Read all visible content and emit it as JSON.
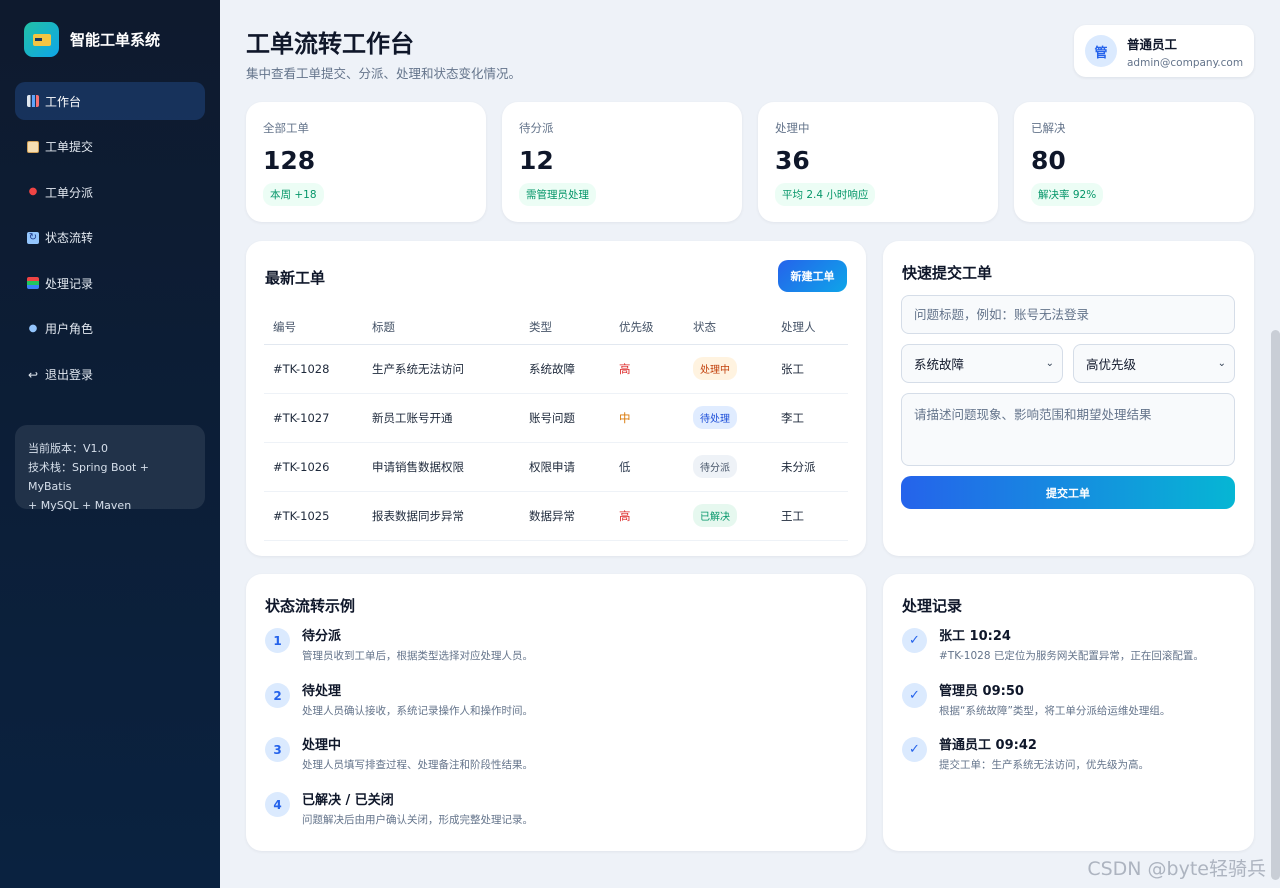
{
  "sidebar": {
    "brand": "智能工单系统",
    "items": [
      {
        "icon": "bar-chart-icon",
        "label": "工作台",
        "active": true
      },
      {
        "icon": "memo-icon",
        "label": "工单提交"
      },
      {
        "icon": "pin-icon",
        "label": "工单分派"
      },
      {
        "icon": "cycle-icon",
        "label": "状态流转"
      },
      {
        "icon": "books-icon",
        "label": "处理记录"
      },
      {
        "icon": "users-icon",
        "label": "用户角色"
      },
      {
        "icon": "return-icon",
        "label": "退出登录"
      }
    ],
    "version": {
      "line1": "当前版本：V1.0",
      "line2": "技术栈：Spring Boot + MyBatis",
      "line3": "+ MySQL + Maven"
    }
  },
  "header": {
    "title": "工单流转工作台",
    "subtitle": "集中查看工单提交、分派、处理和状态变化情况。",
    "user": {
      "avatar": "管",
      "name": "普通员工",
      "email": "admin@company.com"
    }
  },
  "stats": [
    {
      "label": "全部工单",
      "value": "128",
      "badge": "本周 +18"
    },
    {
      "label": "待分派",
      "value": "12",
      "badge": "需管理员处理"
    },
    {
      "label": "处理中",
      "value": "36",
      "badge": "平均 2.4 小时响应"
    },
    {
      "label": "已解决",
      "value": "80",
      "badge": "解决率 92%"
    }
  ],
  "tickets": {
    "title": "最新工单",
    "new_button": "新建工单",
    "columns": [
      "编号",
      "标题",
      "类型",
      "优先级",
      "状态",
      "处理人"
    ],
    "rows": [
      {
        "id": "#TK-1028",
        "title": "生产系统无法访问",
        "type": "系统故障",
        "priority": "高",
        "status": "处理中",
        "assignee": "张工"
      },
      {
        "id": "#TK-1027",
        "title": "新员工账号开通",
        "type": "账号问题",
        "priority": "中",
        "status": "待处理",
        "assignee": "李工"
      },
      {
        "id": "#TK-1026",
        "title": "申请销售数据权限",
        "type": "权限申请",
        "priority": "低",
        "status": "待分派",
        "assignee": "未分派"
      },
      {
        "id": "#TK-1025",
        "title": "报表数据同步异常",
        "type": "数据异常",
        "priority": "高",
        "status": "已解决",
        "assignee": "王工"
      }
    ]
  },
  "quick": {
    "title": "快速提交工单",
    "title_placeholder": "问题标题，例如：账号无法登录",
    "type_value": "系统故障",
    "priority_value": "高优先级",
    "desc_placeholder": "请描述问题现象、影响范围和期望处理结果",
    "submit": "提交工单"
  },
  "flow": {
    "title": "状态流转示例",
    "steps": [
      {
        "num": "1",
        "title": "待分派",
        "desc": "管理员收到工单后，根据类型选择对应处理人员。"
      },
      {
        "num": "2",
        "title": "待处理",
        "desc": "处理人员确认接收，系统记录操作人和操作时间。"
      },
      {
        "num": "3",
        "title": "处理中",
        "desc": "处理人员填写排查过程、处理备注和阶段性结果。"
      },
      {
        "num": "4",
        "title": "已解决 / 已关闭",
        "desc": "问题解决后由用户确认关闭，形成完整处理记录。"
      }
    ]
  },
  "records": {
    "title": "处理记录",
    "items": [
      {
        "title": "张工 10:24",
        "desc": "#TK-1028 已定位为服务网关配置异常，正在回滚配置。"
      },
      {
        "title": "管理员 09:50",
        "desc": "根据“系统故障”类型，将工单分派给运维处理组。"
      },
      {
        "title": "普通员工 09:42",
        "desc": "提交工单：生产系统无法访问，优先级为高。"
      }
    ]
  },
  "watermark": "CSDN @byte轻骑兵"
}
